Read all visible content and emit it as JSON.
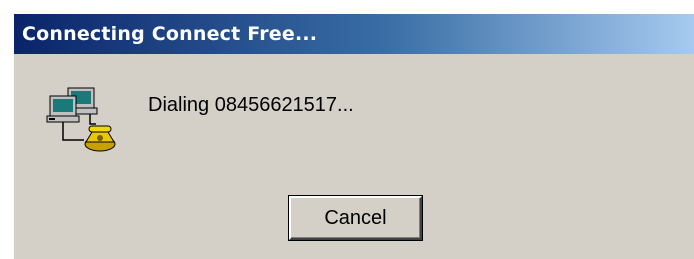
{
  "window": {
    "title": "Connecting Connect Free..."
  },
  "status": {
    "message": "Dialing 08456621517...",
    "icon": "dialup-networking-icon"
  },
  "buttons": {
    "cancel_label": "Cancel"
  },
  "colors": {
    "dialog_background": "#d4d0c8",
    "title_gradient_start": "#0a246a",
    "title_gradient_end": "#a6caf0",
    "title_text": "#ffffff"
  }
}
